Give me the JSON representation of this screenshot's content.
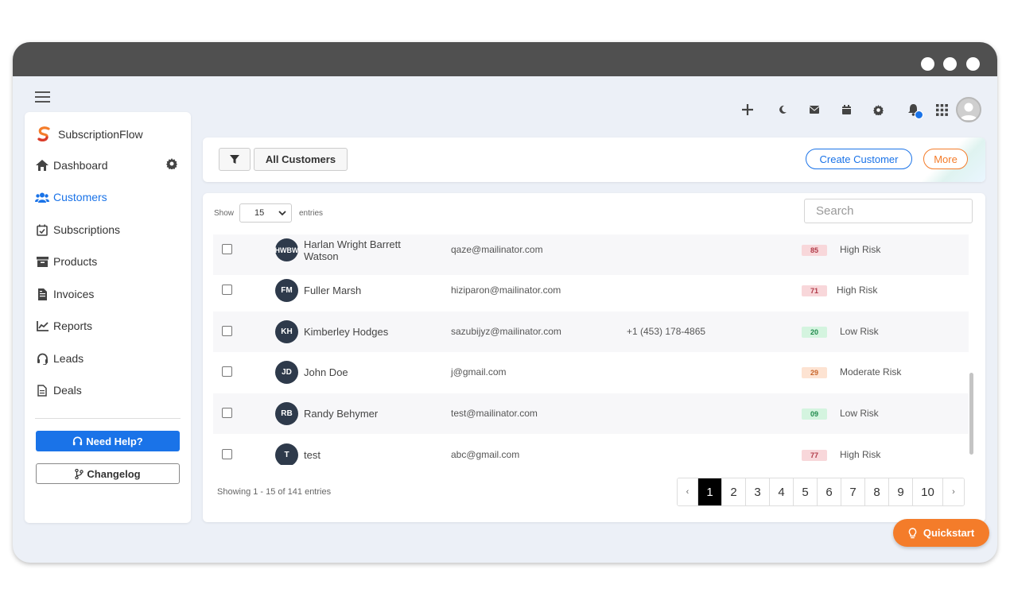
{
  "app": {
    "brand": "SubscriptionFlow"
  },
  "sidebar": {
    "items": [
      {
        "label": "Dashboard",
        "icon": "home-icon"
      },
      {
        "label": "Customers",
        "icon": "users-icon",
        "active": true
      },
      {
        "label": "Subscriptions",
        "icon": "calendar-check-icon"
      },
      {
        "label": "Products",
        "icon": "archive-icon"
      },
      {
        "label": "Invoices",
        "icon": "invoice-icon"
      },
      {
        "label": "Reports",
        "icon": "chart-line-icon"
      },
      {
        "label": "Leads",
        "icon": "headset-icon"
      },
      {
        "label": "Deals",
        "icon": "document-icon"
      }
    ],
    "help_label": "Need Help?",
    "changelog_label": "Changelog"
  },
  "toolbar": {
    "view_label": "All Customers",
    "create_label": "Create Customer",
    "more_label": "More"
  },
  "table": {
    "show_label": "Show",
    "page_size": "15",
    "entries_label": "entries",
    "search_placeholder": "Search",
    "rows": [
      {
        "initials": "HWBW",
        "name": "Harlan Wright Barrett Watson",
        "email": "qaze@mailinator.com",
        "phone": "",
        "score": "85",
        "risk": "High Risk",
        "level": "high"
      },
      {
        "initials": "FM",
        "name": "Fuller Marsh",
        "email": "hiziparon@mailinator.com",
        "phone": "",
        "score": "71",
        "risk": "High Risk",
        "level": "high"
      },
      {
        "initials": "KH",
        "name": "Kimberley Hodges",
        "email": "sazubijyz@mailinator.com",
        "phone": "+1 (453) 178-4865",
        "score": "20",
        "risk": "Low Risk",
        "level": "low"
      },
      {
        "initials": "JD",
        "name": "John Doe",
        "email": "j@gmail.com",
        "phone": "",
        "score": "29",
        "risk": "Moderate Risk",
        "level": "mod"
      },
      {
        "initials": "RB",
        "name": "Randy Behymer",
        "email": "test@mailinator.com",
        "phone": "",
        "score": "09",
        "risk": "Low Risk",
        "level": "low"
      },
      {
        "initials": "T",
        "name": "test",
        "email": "abc@gmail.com",
        "phone": "",
        "score": "77",
        "risk": "High Risk",
        "level": "high"
      }
    ],
    "showing_text": "Showing 1 - 15 of 141 entries",
    "pagination": {
      "prev": "‹",
      "pages": [
        "1",
        "2",
        "3",
        "4",
        "5",
        "6",
        "7",
        "8",
        "9",
        "10"
      ],
      "current": "1",
      "next": "›"
    }
  },
  "quickstart_label": "Quickstart",
  "colors": {
    "accent": "#1a73e8",
    "orange": "#f47c2a",
    "titlebar": "#505050",
    "background": "#ecf0f7",
    "avatar": "#2e3a4b"
  }
}
